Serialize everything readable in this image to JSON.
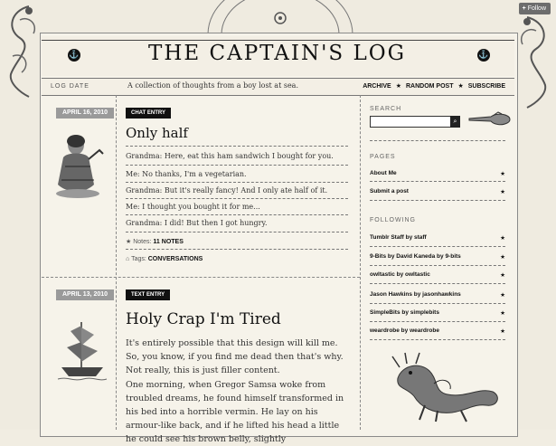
{
  "follow": {
    "label": "Follow"
  },
  "header": {
    "title": "THE CAPTAIN'S LOG"
  },
  "nav": {
    "label": "LOG DATE",
    "tagline": "A collection of thoughts from a boy lost at sea.",
    "links": [
      "ARCHIVE",
      "RANDOM POST",
      "SUBSCRIBE"
    ]
  },
  "posts": [
    {
      "date": "APRIL 16, 2010",
      "type": "CHAT ENTRY",
      "title": "Only half",
      "lines": [
        "Grandma: Here, eat this ham sandwich I bought for you.",
        "Me: No thanks, I'm a vegetarian.",
        "Grandma: But it's really fancy! And I only ate half of it.",
        "Me: I thought you bought it for me...",
        "Grandma: I did! But then I got hungry."
      ],
      "notes_label": "Notes:",
      "notes": "11 NOTES",
      "tags_label": "Tags:",
      "tags": "CONVERSATIONS"
    },
    {
      "date": "APRIL 13, 2010",
      "type": "TEXT ENTRY",
      "title": "Holy Crap I'm Tired",
      "para1": "It's entirely possible that this design will kill me. So, you know, if you find me dead then that's why. Not really, this is just filler content.",
      "para2": "One morning, when Gregor Samsa woke from troubled dreams, he found himself transformed in his bed into a horrible vermin. He lay on his armour-like back, and if he lifted his head a little he could see his brown belly, slightly"
    }
  ],
  "sidebar": {
    "search_label": "SEARCH",
    "search_value": "",
    "pages_label": "PAGES",
    "pages": [
      "About Me",
      "Submit a post"
    ],
    "following_label": "FOLLOWING",
    "following": [
      "Tumblr Staff by staff",
      "9-Bits by David Kaneda by 9-bits",
      "owltastic by owltastic",
      "Jason Hawkins by jasonhawkins",
      "SimpleBits by simplebits",
      "weardrobe by weardrobe"
    ],
    "star": "★"
  },
  "colors": {
    "ink": "#111111",
    "paper": "#f6f3ea",
    "ribbon": "#9a9a9a"
  }
}
